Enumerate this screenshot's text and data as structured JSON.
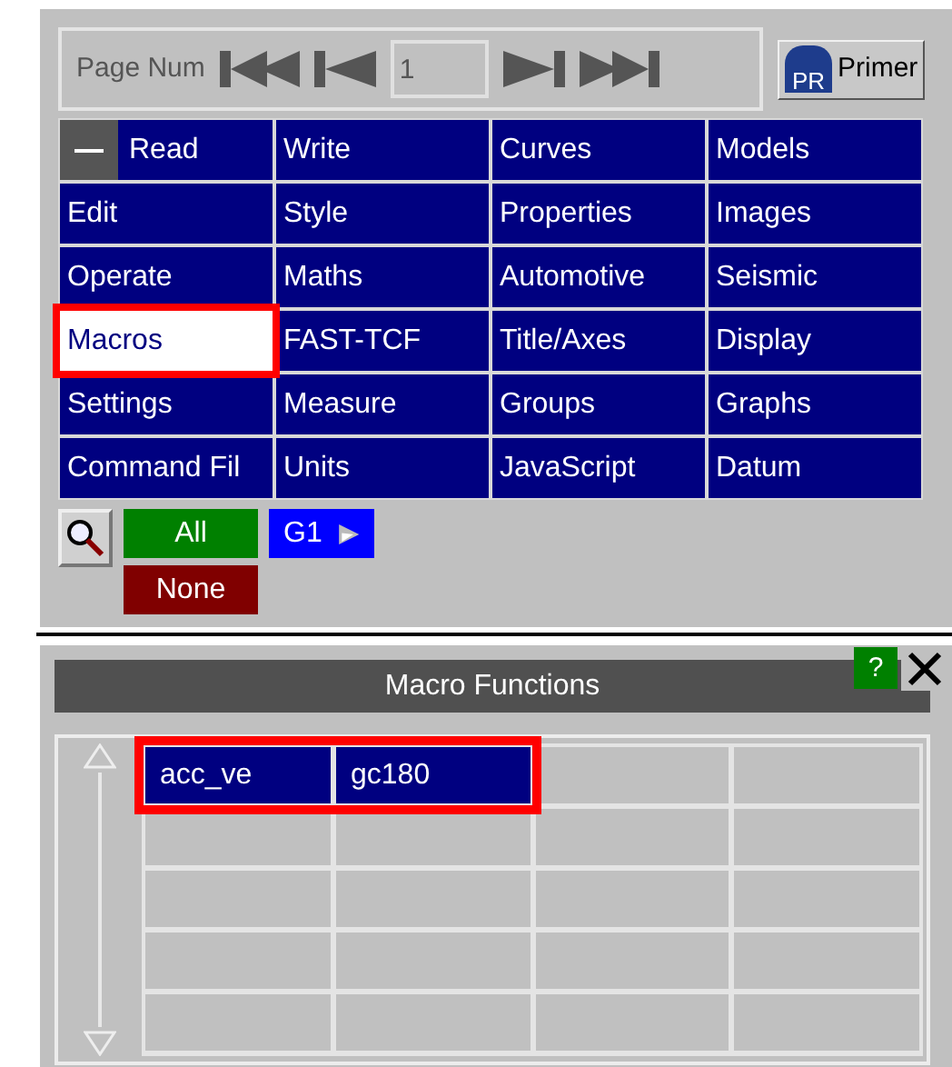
{
  "toolbar": {
    "label": "Page Num",
    "page": "1",
    "logo": "PR",
    "primer": "Primer"
  },
  "menu": [
    {
      "label": "Read",
      "kind": "toggle",
      "selected": false,
      "highlighted": false
    },
    {
      "label": "Write",
      "kind": "plain",
      "selected": false,
      "highlighted": false
    },
    {
      "label": "Curves",
      "kind": "plain",
      "selected": false,
      "highlighted": false
    },
    {
      "label": "Models",
      "kind": "plain",
      "selected": false,
      "highlighted": false
    },
    {
      "label": "Edit",
      "kind": "plain",
      "selected": false,
      "highlighted": false
    },
    {
      "label": "Style",
      "kind": "plain",
      "selected": false,
      "highlighted": false
    },
    {
      "label": "Properties",
      "kind": "plain",
      "selected": false,
      "highlighted": false
    },
    {
      "label": "Images",
      "kind": "plain",
      "selected": false,
      "highlighted": false
    },
    {
      "label": "Operate",
      "kind": "plain",
      "selected": false,
      "highlighted": false
    },
    {
      "label": "Maths",
      "kind": "plain",
      "selected": false,
      "highlighted": false
    },
    {
      "label": "Automotive",
      "kind": "plain",
      "selected": false,
      "highlighted": false
    },
    {
      "label": "Seismic",
      "kind": "plain",
      "selected": false,
      "highlighted": false
    },
    {
      "label": "Macros",
      "kind": "plain",
      "selected": true,
      "highlighted": true
    },
    {
      "label": "FAST-TCF",
      "kind": "plain",
      "selected": false,
      "highlighted": false
    },
    {
      "label": "Title/Axes",
      "kind": "plain",
      "selected": false,
      "highlighted": false
    },
    {
      "label": "Display",
      "kind": "plain",
      "selected": false,
      "highlighted": false
    },
    {
      "label": "Settings",
      "kind": "plain",
      "selected": false,
      "highlighted": false
    },
    {
      "label": "Measure",
      "kind": "plain",
      "selected": false,
      "highlighted": false
    },
    {
      "label": "Groups",
      "kind": "plain",
      "selected": false,
      "highlighted": false
    },
    {
      "label": "Graphs",
      "kind": "plain",
      "selected": false,
      "highlighted": false
    },
    {
      "label": "Command Fil",
      "kind": "plain",
      "selected": false,
      "highlighted": false
    },
    {
      "label": "Units",
      "kind": "plain",
      "selected": false,
      "highlighted": false
    },
    {
      "label": "JavaScript",
      "kind": "plain",
      "selected": false,
      "highlighted": false
    },
    {
      "label": "Datum",
      "kind": "plain",
      "selected": false,
      "highlighted": false
    }
  ],
  "filters": {
    "all": "All",
    "none": "None",
    "group": "G1"
  },
  "dialog": {
    "title": "Macro Functions",
    "help": "?"
  },
  "table": {
    "items": [
      {
        "label": "acc_ve",
        "selected": true,
        "highlighted": true
      },
      {
        "label": "gc180",
        "selected": true,
        "highlighted": true
      }
    ]
  }
}
